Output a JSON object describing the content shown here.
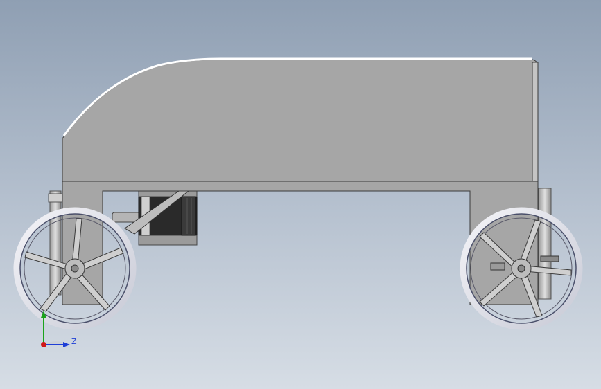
{
  "viewport": {
    "background_top": "#8f9fb3",
    "background_bottom": "#d6dde5"
  },
  "model": {
    "body_color": "#a6a6a6",
    "edge_color": "#3a3a3a",
    "highlight_color": "#ffffff",
    "motor_color": "#2a2a2a",
    "wheel_rim_color": "#e8e8ee",
    "wheel_rim_outline": "#4a4f6a"
  },
  "triad": {
    "z_label": "Z",
    "y_color": "#1aa31a",
    "z_color": "#1f3fd6",
    "x_color": "#d01818"
  }
}
